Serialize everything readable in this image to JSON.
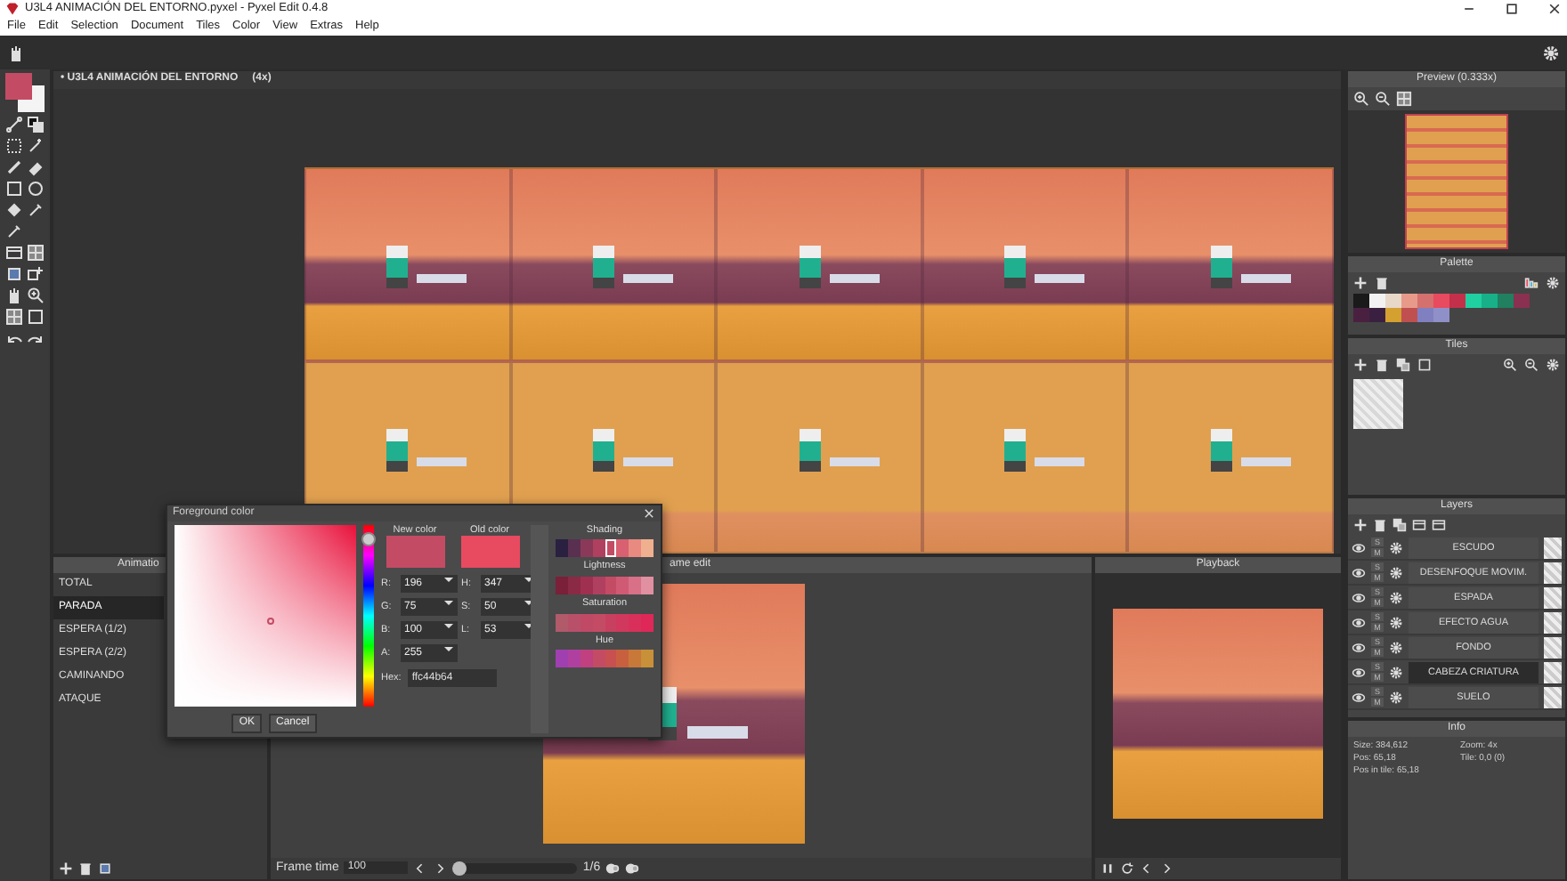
{
  "window": {
    "title": "U3L4 ANIMACIÓN DEL ENTORNO.pyxel - Pyxel Edit 0.4.8"
  },
  "menu": [
    "File",
    "Edit",
    "Selection",
    "Document",
    "Tiles",
    "Color",
    "View",
    "Extras",
    "Help"
  ],
  "tool_colors": [
    {
      "color": "#c44b64"
    },
    {
      "color": "#f4f4f4"
    }
  ],
  "canvas_tab": {
    "title": "• U3L4 ANIMACIÓN DEL ENTORNO",
    "zoom": "(4x)"
  },
  "preview": {
    "title": "Preview (0.333x)"
  },
  "palette": {
    "title": "Palette",
    "colors": [
      {
        "color": "#1a1a1a"
      },
      {
        "color": "#f2f2f2"
      },
      {
        "color": "#e8d8c8"
      },
      {
        "color": "#e89a8a"
      },
      {
        "color": "#d4706e"
      },
      {
        "color": "#e84a5f"
      },
      {
        "color": "#c4304a"
      },
      {
        "color": "#20d0a0"
      },
      {
        "color": "#18b088"
      },
      {
        "color": "#208060"
      },
      {
        "color": "#8a3050"
      },
      {
        "color": "#4a2040"
      },
      {
        "color": "#3a2040"
      },
      {
        "color": "#d4a030"
      },
      {
        "color": "#c05050"
      },
      {
        "color": "#8080c0"
      },
      {
        "color": "#9090c8"
      }
    ]
  },
  "tiles": {
    "title": "Tiles"
  },
  "layers": {
    "title": "Layers",
    "items": [
      {
        "name": "ESCUDO",
        "solo_label": "S",
        "mute_label": "M",
        "visible": true,
        "selected": false
      },
      {
        "name": "DESENFOQUE MOVIM.",
        "solo_label": "S",
        "mute_label": "M",
        "visible": true,
        "selected": false
      },
      {
        "name": "ESPADA",
        "solo_label": "S",
        "mute_label": "M",
        "visible": true,
        "selected": false
      },
      {
        "name": "EFECTO AGUA",
        "solo_label": "S",
        "mute_label": "M",
        "visible": true,
        "selected": false
      },
      {
        "name": "FONDO",
        "solo_label": "S",
        "mute_label": "M",
        "visible": true,
        "selected": false
      },
      {
        "name": "CABEZA CRIATURA",
        "solo_label": "S",
        "mute_label": "M",
        "visible": true,
        "selected": true
      },
      {
        "name": "SUELO",
        "solo_label": "S",
        "mute_label": "M",
        "visible": true,
        "selected": false
      }
    ]
  },
  "info": {
    "title": "Info",
    "lines": [
      "Size: 384,612",
      "Zoom: 4x",
      "Pos: 65,18",
      "Tile: 0,0 (0)",
      "Pos in tile: 65,18"
    ]
  },
  "animations": {
    "title": "Animatio",
    "items": [
      {
        "name": "TOTAL",
        "selected": false
      },
      {
        "name": "PARADA",
        "selected": true
      },
      {
        "name": "ESPERA (1/2)",
        "selected": false
      },
      {
        "name": "ESPERA (2/2)",
        "selected": false
      },
      {
        "name": "CAMINANDO",
        "selected": false
      },
      {
        "name": "ATAQUE",
        "selected": false
      }
    ]
  },
  "frame_edit": {
    "title": "ame edit",
    "frame_time_label": "Frame time",
    "frame_time": "100",
    "frame_counter": "1/6",
    "level": 0
  },
  "playback": {
    "title": "Playback"
  },
  "color_dialog": {
    "title": "Foreground color",
    "hue_slider": {
      "level": 0.04
    },
    "compare": [
      {
        "label": "New color",
        "color": "#c44b64"
      },
      {
        "label": "Old color",
        "color": "#e84a5f"
      }
    ],
    "fields": [
      {
        "label": "R:",
        "value": "196"
      },
      {
        "label": "H:",
        "value": "347"
      },
      {
        "label": "G:",
        "value": "75"
      },
      {
        "label": "S:",
        "value": "50"
      },
      {
        "label": "B:",
        "value": "100"
      },
      {
        "label": "L:",
        "value": "53"
      },
      {
        "label": "A:",
        "value": "255"
      }
    ],
    "hex_label": "Hex:",
    "hex": "ffc44b64",
    "buttons": [
      "OK",
      "Cancel"
    ],
    "strips": [
      {
        "title": "Shading",
        "swatches": [
          {
            "color": "#2a2040",
            "selected": false
          },
          {
            "color": "#5a3050",
            "selected": false
          },
          {
            "color": "#8a3a58",
            "selected": false
          },
          {
            "color": "#b04060",
            "selected": false
          },
          {
            "color": "#c44b64",
            "selected": true
          },
          {
            "color": "#d86070",
            "selected": false
          },
          {
            "color": "#e88a80",
            "selected": false
          },
          {
            "color": "#f0b090",
            "selected": false
          }
        ]
      },
      {
        "title": "Lightness",
        "swatches": [
          {
            "color": "#7a2038",
            "selected": false
          },
          {
            "color": "#8a2a44",
            "selected": false
          },
          {
            "color": "#a03050",
            "selected": false
          },
          {
            "color": "#b04060",
            "selected": false
          },
          {
            "color": "#c44b64",
            "selected": false
          },
          {
            "color": "#d05a74",
            "selected": false
          },
          {
            "color": "#d87088",
            "selected": false
          },
          {
            "color": "#e090a0",
            "selected": false
          }
        ]
      },
      {
        "title": "Saturation",
        "swatches": [
          {
            "color": "#b05a6a",
            "selected": false
          },
          {
            "color": "#b8506a",
            "selected": false
          },
          {
            "color": "#c04a66",
            "selected": false
          },
          {
            "color": "#c44b64",
            "selected": false
          },
          {
            "color": "#c84060",
            "selected": false
          },
          {
            "color": "#d0385e",
            "selected": false
          },
          {
            "color": "#d8305a",
            "selected": false
          },
          {
            "color": "#e02858",
            "selected": false
          }
        ]
      },
      {
        "title": "Hue",
        "swatches": [
          {
            "color": "#a040b0",
            "selected": false
          },
          {
            "color": "#b040a0",
            "selected": false
          },
          {
            "color": "#c04080",
            "selected": false
          },
          {
            "color": "#c44b64",
            "selected": false
          },
          {
            "color": "#c85050",
            "selected": false
          },
          {
            "color": "#c86040",
            "selected": false
          },
          {
            "color": "#c87838",
            "selected": false
          },
          {
            "color": "#c89038",
            "selected": false
          }
        ]
      }
    ]
  }
}
